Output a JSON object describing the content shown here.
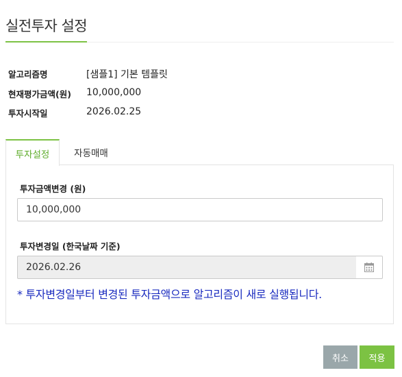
{
  "page": {
    "title": "실전투자 설정"
  },
  "info": {
    "rows": [
      {
        "label": "알고리즘명",
        "value": "[샘플1] 기본 템플릿"
      },
      {
        "label": "현재평가금액(원)",
        "value": "10,000,000"
      },
      {
        "label": "투자시작일",
        "value": "2026.02.25"
      }
    ]
  },
  "tabs": [
    {
      "label": "투자설정",
      "active": true
    },
    {
      "label": "자동매매",
      "active": false
    }
  ],
  "form": {
    "amount_label": "투자금액변경 (원)",
    "amount_value": "10,000,000",
    "date_label": "투자변경일 (한국날짜 기준)",
    "date_value": "2026.02.26",
    "notice": "* 투자변경일부터 변경된 투자금액으로 알고리즘이 새로 실행됩니다."
  },
  "buttons": {
    "cancel": "취소",
    "apply": "적용"
  },
  "colors": {
    "accent": "#7cc243",
    "notice": "#1a2bbf",
    "cancel_bg": "#9aa7aa"
  },
  "icons": {
    "calendar": "calendar-icon"
  }
}
